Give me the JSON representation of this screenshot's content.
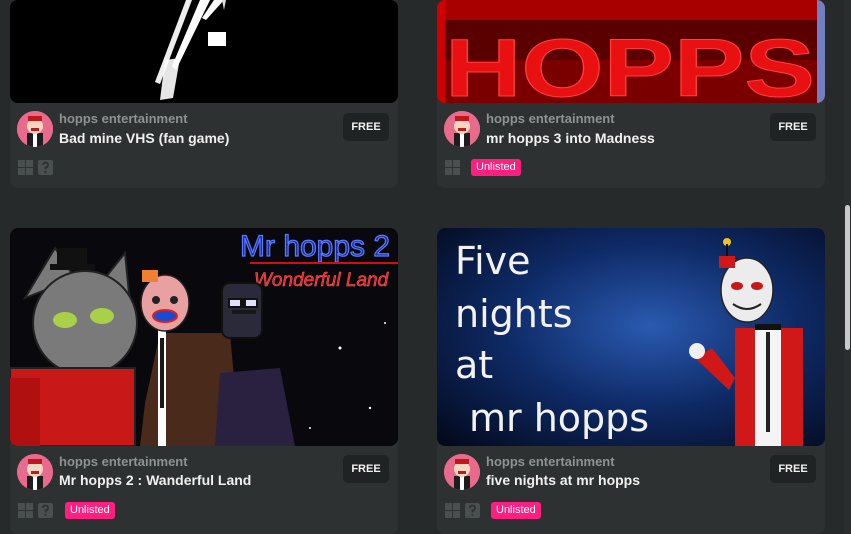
{
  "games": [
    {
      "author": "hopps entertainment",
      "title": "Bad mine VHS (fan game)",
      "price": "FREE",
      "badge": ""
    },
    {
      "author": "hopps entertainment",
      "title": "mr hopps 3 into Madness",
      "price": "FREE",
      "badge": "Unlisted",
      "thumb_text": "HOPPS"
    },
    {
      "author": "hopps entertainment",
      "title": "Mr hopps 2 : Wanderful Land",
      "price": "FREE",
      "badge": "Unlisted",
      "thumb_title": "Mr hopps 2",
      "thumb_subtitle": "Wonderful Land"
    },
    {
      "author": "hopps entertainment",
      "title": "five nights at mr hopps",
      "price": "FREE",
      "badge": "Unlisted",
      "thumb_lines": [
        "Five",
        "nights",
        "at",
        "mr hopps"
      ]
    }
  ],
  "colors": {
    "badge": "#ff1f81",
    "card": "#2e3131",
    "background": "#272a2a"
  },
  "icons": [
    "windows-icon",
    "unknown-platform-icon"
  ]
}
